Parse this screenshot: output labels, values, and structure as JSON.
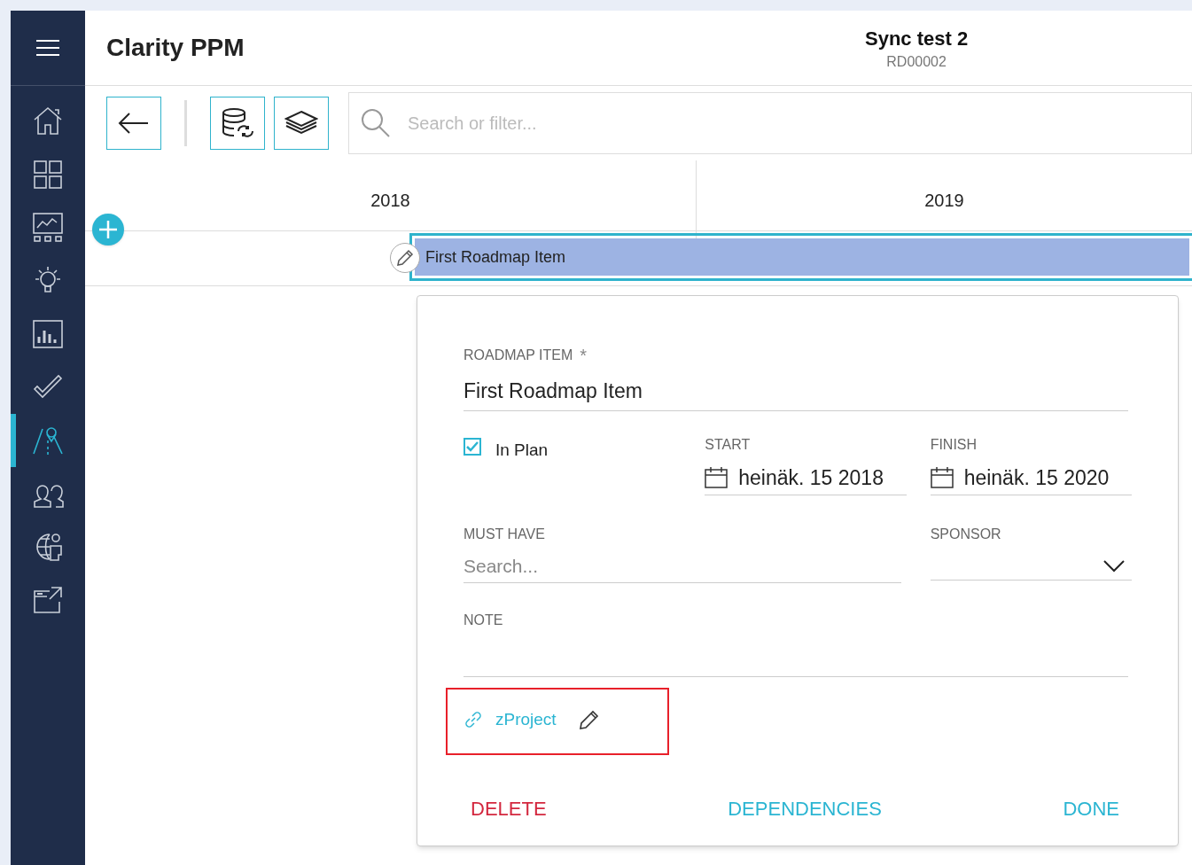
{
  "app": {
    "title": "Clarity PPM"
  },
  "record": {
    "name": "Sync test 2",
    "code": "RD00002"
  },
  "sidebar": {
    "items": [
      {
        "selected": false
      },
      {
        "selected": false
      },
      {
        "selected": false
      },
      {
        "selected": false
      },
      {
        "selected": false
      },
      {
        "selected": false
      },
      {
        "selected": true
      },
      {
        "selected": false
      },
      {
        "selected": false
      },
      {
        "selected": false
      }
    ]
  },
  "search": {
    "placeholder": "Search or filter..."
  },
  "timeline": {
    "years": [
      "2018",
      "2019"
    ],
    "bar": {
      "label": "First Roadmap Item"
    }
  },
  "editor": {
    "name_field": {
      "label": "ROADMAP ITEM",
      "required_mark": "*",
      "value": "First Roadmap Item"
    },
    "in_plan": {
      "label": "In Plan",
      "checked": true
    },
    "start": {
      "label": "START",
      "value": "heinäk. 15 2018"
    },
    "finish": {
      "label": "FINISH",
      "value": "heinäk. 15 2020"
    },
    "must_have": {
      "label": "MUST HAVE",
      "placeholder": "Search..."
    },
    "sponsor": {
      "label": "SPONSOR"
    },
    "note": {
      "label": "NOTE"
    },
    "link": {
      "label": "zProject",
      "highlighted": true
    },
    "actions": [
      {
        "label": "DELETE",
        "kind": "danger"
      },
      {
        "label": "DEPENDENCIES",
        "kind": "normal"
      },
      {
        "label": "DONE",
        "kind": "normal"
      }
    ]
  }
}
